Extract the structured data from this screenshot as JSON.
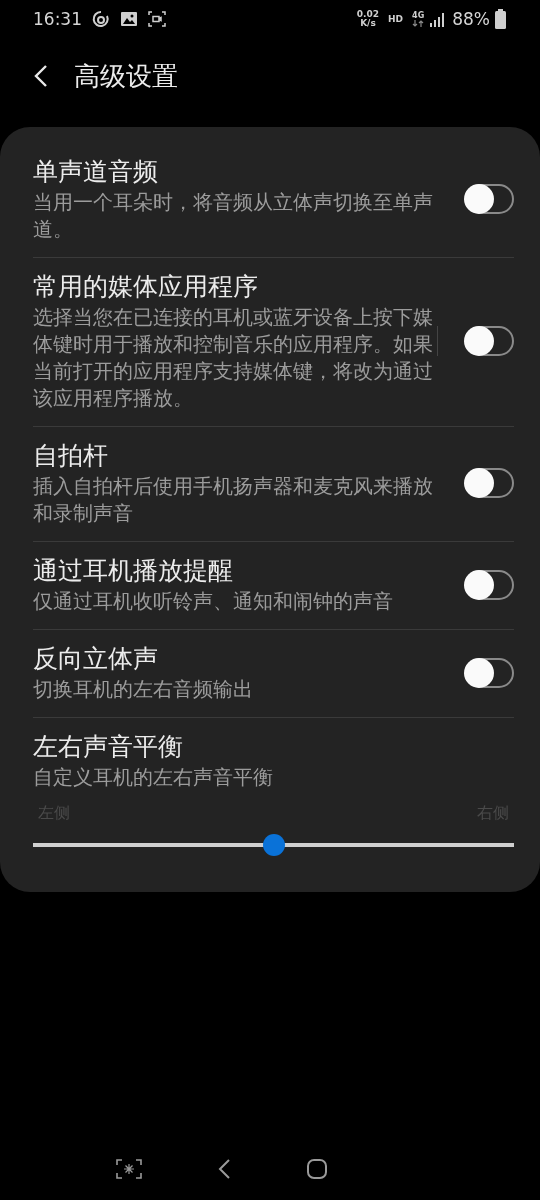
{
  "status_bar": {
    "time": "16:31",
    "speed_value": "0.02",
    "speed_unit": "K/s",
    "hd": "HD",
    "network": "4G",
    "battery": "88%"
  },
  "header": {
    "title": "高级设置"
  },
  "settings": [
    {
      "kind": "toggle",
      "title": "单声道音频",
      "subtitle": "当用一个耳朵时，将音频从立体声切换至单声道。",
      "on": false,
      "divider": false
    },
    {
      "kind": "toggle",
      "title": "常用的媒体应用程序",
      "subtitle": "选择当您在已连接的耳机或蓝牙设备上按下媒体键时用于播放和控制音乐的应用程序。如果当前打开的应用程序支持媒体键，将改为通过该应用程序播放。",
      "on": false,
      "divider": true
    },
    {
      "kind": "toggle",
      "title": "自拍杆",
      "subtitle": "插入自拍杆后使用手机扬声器和麦克风来播放和录制声音",
      "on": false,
      "divider": false
    },
    {
      "kind": "toggle",
      "title": "通过耳机播放提醒",
      "subtitle": "仅通过耳机收听铃声、通知和闹钟的声音",
      "on": false,
      "divider": false
    },
    {
      "kind": "toggle",
      "title": "反向立体声",
      "subtitle": "切换耳机的左右音频输出",
      "on": false,
      "divider": false
    },
    {
      "kind": "slider",
      "title": "左右声音平衡",
      "subtitle": "自定义耳机的左右声音平衡",
      "label_left": "左侧",
      "label_right": "右侧",
      "level": 0.5
    }
  ]
}
